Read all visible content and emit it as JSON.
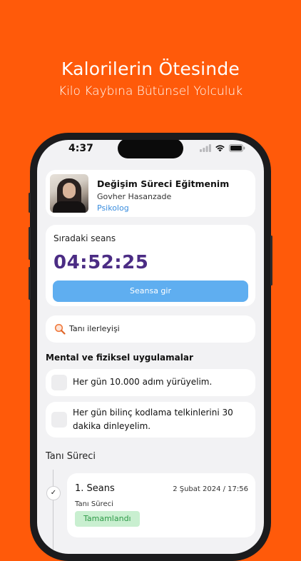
{
  "hero": {
    "title": "Kalorilerin Ötesinde",
    "subtitle": "Kilo Kaybına Bütünsel Yolculuk"
  },
  "status_bar": {
    "time": "4:37",
    "icons": [
      "signal-icon",
      "wifi-icon",
      "battery-icon"
    ]
  },
  "coach": {
    "title": "Değişim Süreci Eğitmenim",
    "name": "Govher Hasanzade",
    "role": "Psikolog"
  },
  "session": {
    "label": "Sıradaki seans",
    "countdown": "04:52:25",
    "join_label": "Seansa gir"
  },
  "progress": {
    "icon": "magnifier-icon",
    "label": "Tanı ilerleyişi"
  },
  "practices": {
    "title": "Mental ve fiziksel uygulamalar",
    "tasks": [
      "Her gün 10.000 adım yürüyelim.",
      "Her gün bilinç kodlama telkinlerini 30 dakika dinleyelim."
    ]
  },
  "timeline": {
    "title": "Tanı Süreci",
    "steps": [
      {
        "title": "1. Seans",
        "date": "2 Şubat 2024 / 17:56",
        "subtitle": "Tanı Süreci",
        "status": "Tamamlandı"
      }
    ]
  },
  "colors": {
    "background": "#FF5A0A",
    "countdown": "#4B2C84",
    "primary_button": "#5FAEF0",
    "link": "#3A8DDE",
    "badge_bg": "#C9EFD0",
    "badge_text": "#2E9A48"
  }
}
